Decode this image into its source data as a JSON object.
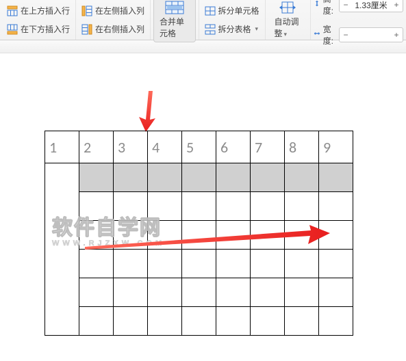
{
  "ribbon": {
    "insert": {
      "row_above": "在上方插入行",
      "row_below": "在下方插入行",
      "col_left": "在左侧插入列",
      "col_right": "在右侧插入列"
    },
    "merge": "合并单元格",
    "split_cells": "拆分单元格",
    "split_table": "拆分表格",
    "autofit": "自动调整",
    "height_label": "高度:",
    "width_label": "宽度:",
    "height_value": "1.33厘米",
    "width_value": "",
    "minus": "−",
    "plus": "+",
    "dd": "▾"
  },
  "table": {
    "headers": [
      "1",
      "2",
      "3",
      "4",
      "5",
      "6",
      "7",
      "8",
      "9"
    ]
  },
  "watermark": {
    "line1": "软件自学网",
    "line2": "WWW.RJZXW.COM"
  }
}
